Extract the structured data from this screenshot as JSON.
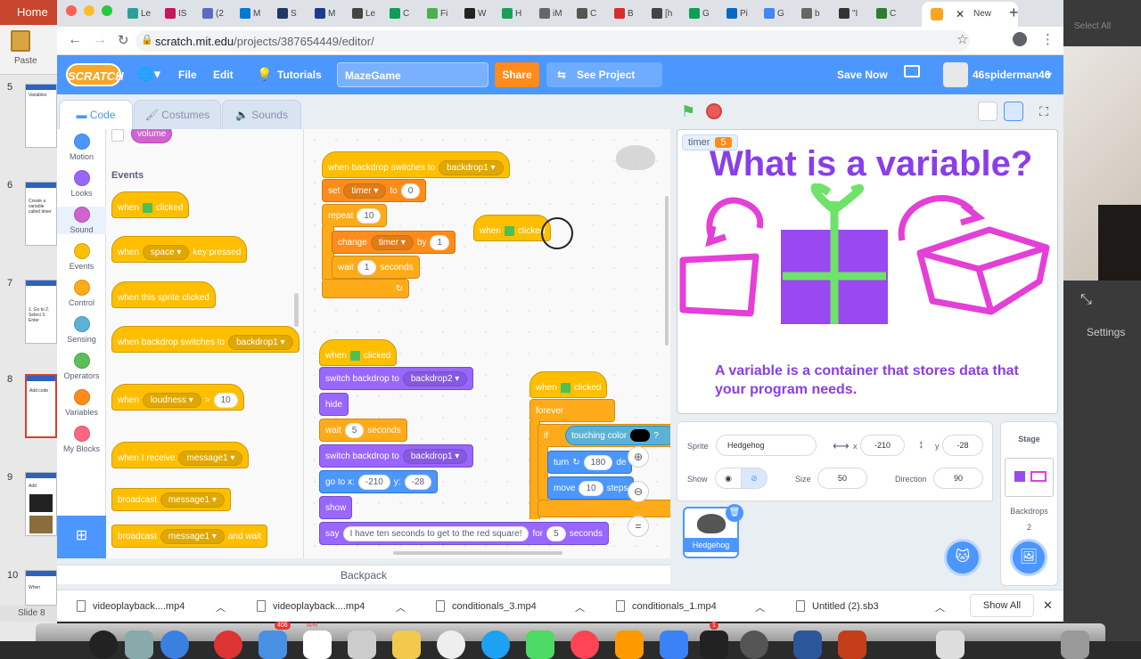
{
  "ppt": {
    "home_tab": "Home",
    "paste_label": "Paste",
    "thumbnails": [
      {
        "num": "5",
        "text": "Variables"
      },
      {
        "num": "6",
        "text": "Create a variable called timer"
      },
      {
        "num": "7",
        "text": "1. Go to 2. Select 3. Enter"
      },
      {
        "num": "8",
        "text": "Add code"
      },
      {
        "num": "9",
        "text": "Add"
      },
      {
        "num": "10",
        "text": "When"
      }
    ],
    "status": "Slide 8",
    "settings": "Settings",
    "select_all": "Select All"
  },
  "browser": {
    "tabs": [
      "Le",
      "IS",
      "(2",
      "M",
      "S",
      "M",
      "Le",
      "C",
      "Fi",
      "W",
      "H",
      "iM",
      "C",
      "B",
      "[h",
      "G",
      "Pi",
      "G",
      "b",
      "\"I",
      "C"
    ],
    "active_tab": "",
    "last_tab": "New",
    "url_host": "scratch.mit.edu",
    "url_path": "/projects/387654449/editor/"
  },
  "menubar": {
    "logo": "SCRATCH",
    "file": "File",
    "edit": "Edit",
    "tutorials": "Tutorials",
    "project_title": "MazeGame",
    "share": "Share",
    "see_project_page": "See Project Page",
    "save_now": "Save Now",
    "username": "46spiderman46"
  },
  "editor_tabs": {
    "code": "Code",
    "costumes": "Costumes",
    "sounds": "Sounds"
  },
  "categories": [
    {
      "label": "Motion",
      "color": "#4c97ff"
    },
    {
      "label": "Looks",
      "color": "#9966ff"
    },
    {
      "label": "Sound",
      "color": "#cf63cf"
    },
    {
      "label": "Events",
      "color": "#ffbf00"
    },
    {
      "label": "Control",
      "color": "#ffab19"
    },
    {
      "label": "Sensing",
      "color": "#5cb1d6"
    },
    {
      "label": "Operators",
      "color": "#59c059"
    },
    {
      "label": "Variables",
      "color": "#ff8c1a"
    },
    {
      "label": "My Blocks",
      "color": "#ff6680"
    }
  ],
  "palette": {
    "volume": "volume",
    "events_heading": "Events",
    "when": "when",
    "clicked": "clicked",
    "key_pressed": "key pressed",
    "key": "space",
    "sprite_clicked": "when this sprite clicked",
    "backdrop_switches": "when backdrop switches to",
    "backdrop1": "backdrop1",
    "loudness": "loudness",
    "gt": ">",
    "loudness_value": "10",
    "receive": "when I receive",
    "message1": "message1",
    "broadcast": "broadcast",
    "and_wait": "and wait"
  },
  "script1": {
    "hat": "when backdrop switches to",
    "backdrop": "backdrop1",
    "set": "set",
    "var": "timer",
    "to": "to",
    "set_value": "0",
    "repeat": "repeat",
    "repeat_count": "10",
    "change": "change",
    "by": "by",
    "change_value": "1",
    "wait": "wait",
    "wait_value": "1",
    "seconds": "seconds"
  },
  "floating": {
    "when": "when",
    "clicked": "clicked"
  },
  "script2": {
    "when": "when",
    "clicked": "clicked",
    "switch_backdrop": "switch backdrop to",
    "backdrop2": "backdrop2",
    "hide": "hide",
    "wait": "wait",
    "wait_value": "5",
    "seconds": "seconds",
    "backdrop1": "backdrop1",
    "goto": "go to x:",
    "x": "-210",
    "y_label": "y:",
    "y": "-28",
    "show": "show",
    "say": "say",
    "say_text": "I have ten seconds to get to the red square!",
    "for": "for",
    "say_secs": "5"
  },
  "script3": {
    "when": "when",
    "clicked": "clicked",
    "forever": "forever",
    "if": "if",
    "touching_color": "touching color",
    "q": "?",
    "turn": "turn",
    "turn_value": "180",
    "degrees": "de",
    "move": "move",
    "move_value": "10",
    "steps": "steps"
  },
  "backpack": "Backpack",
  "stage": {
    "monitor_label": "timer",
    "monitor_value": "5",
    "title": "What is a variable?",
    "subtitle": "A variable is a container that stores data that your program needs."
  },
  "sprite_info": {
    "sprite_label": "Sprite",
    "sprite_name": "Hedgehog",
    "x_label": "x",
    "x": "-210",
    "y_label": "y",
    "y": "-28",
    "show_label": "Show",
    "size_label": "Size",
    "size": "50",
    "direction_label": "Direction",
    "direction": "90",
    "tile_name": "Hedgehog"
  },
  "stage_panel": {
    "title": "Stage",
    "backdrops_label": "Backdrops",
    "backdrops_count": "2"
  },
  "downloads": {
    "items": [
      "videoplayback....mp4",
      "videoplayback....mp4",
      "conditionals_3.mp4",
      "conditionals_1.mp4",
      "Untitled (2).sb3"
    ],
    "show_all": "Show All"
  },
  "dock_badges": {
    "mail": "406",
    "calendar": "APR",
    "notif": "1"
  }
}
